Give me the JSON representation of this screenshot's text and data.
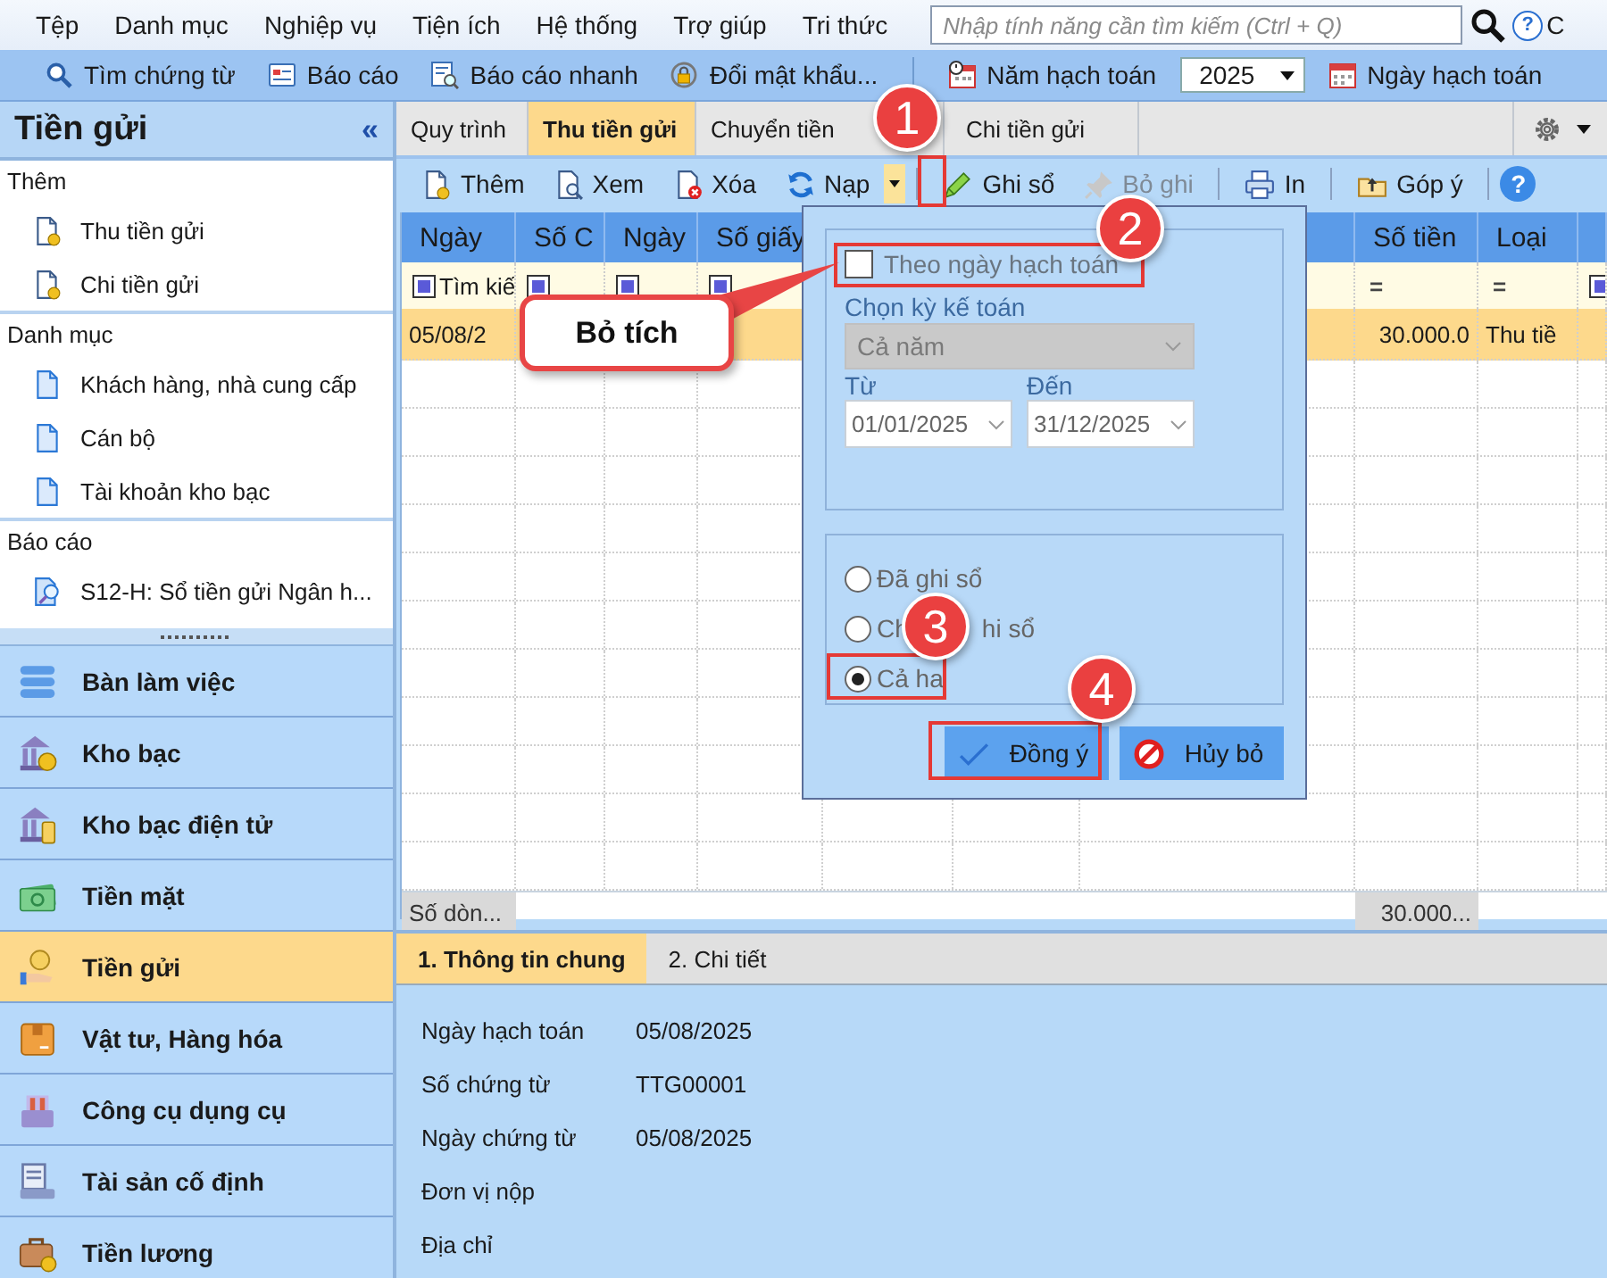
{
  "menu_bar": {
    "items": [
      "Tệp",
      "Danh mục",
      "Nghiệp vụ",
      "Tiện ích",
      "Hệ thống",
      "Trợ giúp",
      "Tri thức"
    ],
    "search": {
      "placeholder": "Nhập tính năng cần tìm kiếm (Ctrl + Q)"
    },
    "help": "?",
    "cut_item": "C"
  },
  "toolbar": {
    "items": [
      {
        "kind": "button",
        "label": "Tìm chứng từ"
      },
      {
        "kind": "button",
        "label": "Báo cáo"
      },
      {
        "kind": "button",
        "label": "Báo cáo nhanh"
      },
      {
        "kind": "button",
        "label": "Đổi mật khẩu..."
      },
      {
        "kind": "separator"
      },
      {
        "kind": "button",
        "label": "Năm hạch toán"
      },
      {
        "kind": "select",
        "value": "2025"
      },
      {
        "kind": "button",
        "label": "Ngày hạch toán"
      }
    ]
  },
  "sidebar": {
    "title": "Tiền gửi",
    "collapse": "«",
    "sections": [
      {
        "title": "Thêm",
        "items": [
          {
            "label": "Thu tiền gửi"
          },
          {
            "label": "Chi tiền gửi"
          }
        ]
      },
      {
        "title": "Danh mục",
        "items": [
          {
            "label": "Khách hàng, nhà cung cấp"
          },
          {
            "label": "Cán bộ"
          },
          {
            "label": "Tài khoản kho bạc"
          }
        ]
      },
      {
        "title": "Báo cáo",
        "items": [
          {
            "label": "S12-H: Sổ tiền gửi Ngân h..."
          }
        ]
      }
    ],
    "modules": [
      {
        "label": "Bàn làm việc",
        "selected": false
      },
      {
        "label": "Kho bạc",
        "selected": false
      },
      {
        "label": "Kho bạc điện tử",
        "selected": false
      },
      {
        "label": "Tiền mặt",
        "selected": false
      },
      {
        "label": "Tiền gửi",
        "selected": true
      },
      {
        "label": "Vật tư, Hàng hóa",
        "selected": false
      },
      {
        "label": "Công cụ dụng cụ",
        "selected": false
      },
      {
        "label": "Tài sản cố định",
        "selected": false
      },
      {
        "label": "Tiền lương",
        "selected": false
      }
    ]
  },
  "tabs": [
    {
      "label": "Quy trình",
      "selected": false
    },
    {
      "label": "Thu tiền gửi",
      "selected": true
    },
    {
      "label": "Chuyển tiền",
      "selected": false
    },
    {
      "label": "Chi tiền gửi",
      "selected": false
    }
  ],
  "actions": [
    {
      "kind": "button",
      "label": "Thêm",
      "disabled": false
    },
    {
      "kind": "button",
      "label": "Xem",
      "disabled": false
    },
    {
      "kind": "button",
      "label": "Xóa",
      "disabled": false
    },
    {
      "kind": "button",
      "label": "Nạp",
      "disabled": false
    },
    {
      "kind": "dropdown"
    },
    {
      "kind": "separator"
    },
    {
      "kind": "button",
      "label": "Ghi sổ",
      "disabled": false
    },
    {
      "kind": "button",
      "label": "Bỏ ghi",
      "disabled": true
    },
    {
      "kind": "separator"
    },
    {
      "kind": "button",
      "label": "In",
      "disabled": false
    },
    {
      "kind": "separator"
    },
    {
      "kind": "button",
      "label": "Góp ý",
      "disabled": false
    },
    {
      "kind": "separator"
    },
    {
      "kind": "help",
      "label": "?"
    }
  ],
  "grid": {
    "columns": [
      {
        "label": "Ngày",
        "filter": {
          "kind": "checkbox",
          "checked": true,
          "text": "Tìm kiế"
        }
      },
      {
        "label": "Số C",
        "filter": {
          "kind": "checkbox",
          "checked": true
        }
      },
      {
        "label": "Ngày",
        "filter": {
          "kind": "checkbox",
          "checked": true
        }
      },
      {
        "label": "Số giấy",
        "filter": {
          "kind": "checkbox",
          "checked": true
        }
      },
      {
        "label": "Số tiền",
        "filter": {
          "kind": "equals",
          "text": "="
        }
      },
      {
        "label": "Loại",
        "filter": {
          "kind": "equals",
          "text": "="
        }
      },
      {
        "filter": {
          "kind": "checkbox",
          "checked": true
        }
      }
    ],
    "rows": [
      {
        "selected": true,
        "date": "05/08/2",
        "amount": "30.000.0",
        "type": "Thu tiề"
      }
    ],
    "footer": {
      "row_count": "Số dòn...",
      "total": "30.000..."
    }
  },
  "detail": {
    "tabs": [
      {
        "label": "1. Thông tin chung",
        "selected": true
      },
      {
        "label": "2. Chi tiết",
        "selected": false
      }
    ],
    "fields": [
      {
        "label": "Ngày hạch toán",
        "value": "05/08/2025"
      },
      {
        "label": "Số chứng từ",
        "value": "TTG00001"
      },
      {
        "label": "Ngày chứng từ",
        "value": "05/08/2025"
      },
      {
        "label": "Đơn vị nộp"
      },
      {
        "label": "Địa chỉ"
      }
    ]
  },
  "popup": {
    "by_date": {
      "label": "Theo ngày hạch toán",
      "checked": false
    },
    "period_label": "Chọn kỳ kế toán",
    "period": {
      "value": "Cả năm",
      "disabled": true
    },
    "from_label": "Từ",
    "from": "01/01/2025",
    "to_label": "Đến",
    "to": "31/12/2025",
    "radios": [
      {
        "label": "Đã ghi sổ",
        "selected": false
      },
      {
        "label": "Ch",
        "tail": "hi sổ",
        "selected": false
      },
      {
        "label": "Cả ha",
        "selected": true
      }
    ],
    "buttons": [
      {
        "kind": "ok",
        "label": "Đồng ý"
      },
      {
        "kind": "cancel",
        "label": "Hủy bỏ"
      }
    ]
  },
  "annotations": {
    "callout": "Bỏ tích",
    "badges": [
      "1",
      "2",
      "3",
      "4"
    ]
  }
}
